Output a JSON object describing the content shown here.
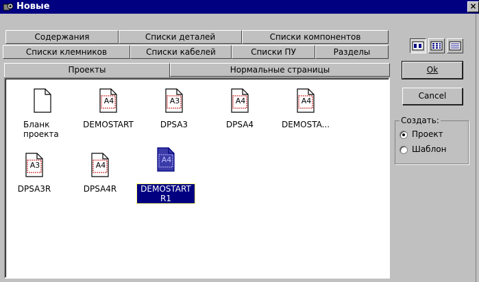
{
  "window": {
    "title": "Новые",
    "close_label": "×"
  },
  "tabs": {
    "row1": [
      "Содержания",
      "Списки деталей",
      "Списки компонентов"
    ],
    "row2": [
      "Списки клемников",
      "Списки кабелей",
      "Списки ПУ",
      "Разделы"
    ],
    "row3": [
      "Проекты",
      "Нормальные страницы"
    ],
    "active": "Проекты"
  },
  "items": [
    {
      "label": "Бланк\nпроекта",
      "icon": "blank-page-icon",
      "sheet": ""
    },
    {
      "label": "DEMOSTART",
      "icon": "a4-sheet-icon",
      "sheet": "A4"
    },
    {
      "label": "DPSA3",
      "icon": "a3-sheet-icon",
      "sheet": "A3"
    },
    {
      "label": "DPSA4",
      "icon": "a4-sheet-icon",
      "sheet": "A4"
    },
    {
      "label": "DEMOSTA...",
      "icon": "a4-sheet-icon",
      "sheet": "A4"
    },
    {
      "label": "DPSA3R",
      "icon": "a3-sheet-icon",
      "sheet": "A3"
    },
    {
      "label": "DPSA4R",
      "icon": "a4-sheet-icon",
      "sheet": "A4"
    },
    {
      "label": "DEMOSTART R1",
      "icon": "a4-sheet-icon",
      "sheet": "A4",
      "selected": true
    }
  ],
  "buttons": {
    "ok": "Ok",
    "cancel": "Cancel"
  },
  "create_group": {
    "label": "Создать:",
    "options": [
      "Проект",
      "Шаблон"
    ],
    "selected": "Проект"
  },
  "colors": {
    "titlebar": "#000080",
    "face": "#c0c0c0",
    "selection": "#000080",
    "sheet_red": "#c00000"
  }
}
